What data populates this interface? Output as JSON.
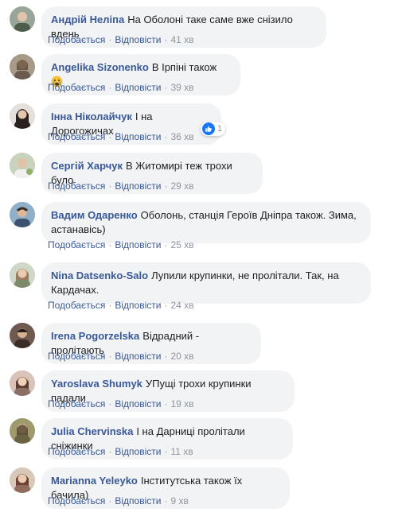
{
  "actions": {
    "like": "Подобається",
    "reply": "Відповісти",
    "separator": "·"
  },
  "comments": [
    {
      "author": "Андрій Неліпа",
      "text": "На Оболоні таке саме вже снізило вдень",
      "time": "41 хв",
      "avatar_color": "#7d8a7a"
    },
    {
      "author": "Angelika Sizonenko",
      "text": "В Ірпіні також",
      "time": "39 хв",
      "emoji": "crying-face-icon",
      "avatar_color": "#6b5a4e"
    },
    {
      "author": "Інна Ніколайчук",
      "text": "І на Дорогожичах",
      "time": "36 хв",
      "reaction": {
        "icon": "thumbs-up-icon",
        "count": "1"
      },
      "avatar_color": "#3a3030"
    },
    {
      "author": "Сергій Харчук",
      "text": "В Житомирі теж трохи було",
      "time": "29 хв",
      "avatar_color": "#a7b59a"
    },
    {
      "author": "Вадим Одаренко",
      "text": "Оболонь, станція Героїв Дніпра також. Зима, астанавісь)",
      "time": "25 хв",
      "avatar_color": "#5c7d9a"
    },
    {
      "author": "Nina Datsenko-Salo",
      "text": "Лупили крупинки, не пролітали. Так, на Кардачах.",
      "time": "24 хв",
      "avatar_color": "#b59f8a"
    },
    {
      "author": "Irena Pogorzelska",
      "text": "Відрадний - пролітають",
      "time": "20 хв",
      "avatar_color": "#4a3b36"
    },
    {
      "author": "Yaroslava Shumyk",
      "text": "УПущі трохи крупинки падали",
      "time": "19 хв",
      "avatar_color": "#8a6f66"
    },
    {
      "author": "Julia Chervinska",
      "text": "І на Дарниці пролітали сніжинки",
      "time": "11 хв",
      "avatar_color": "#7b7355"
    },
    {
      "author": "Marianna Yeleyko",
      "text": "Інститутська також їх бачила)",
      "time": "9 хв",
      "avatar_color": "#8f6c5c"
    }
  ]
}
